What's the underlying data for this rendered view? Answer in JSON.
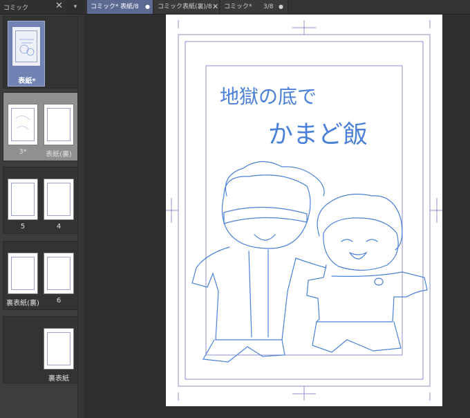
{
  "left_panel": {
    "title": "コミック",
    "close_glyph": "✕",
    "menu_glyph": "▾",
    "spreads": [
      {
        "pages": [
          {
            "label": "表紙*"
          }
        ]
      },
      {
        "pages": [
          {
            "label": "3*"
          },
          {
            "label": "表紙(裏)"
          }
        ]
      },
      {
        "pages": [
          {
            "label": "5"
          },
          {
            "label": "4"
          }
        ]
      },
      {
        "pages": [
          {
            "label": "裏表紙(裏)"
          },
          {
            "label": "6"
          }
        ]
      },
      {
        "pages": [
          {
            "label": "裏表紙"
          }
        ]
      }
    ]
  },
  "tabs": [
    {
      "label": "コミック*",
      "extra": "表紙/8",
      "dot": "●",
      "active": true
    },
    {
      "label": "コミック表紙(裏)/8",
      "close": "✕",
      "active": false
    },
    {
      "label": "コミック*",
      "extra": "3/8",
      "dot": "●",
      "active": false
    }
  ],
  "canvas": {
    "sketch_title_line1": "地獄の底で",
    "sketch_title_line2": "かまど飯",
    "sketch_color": "#4a80d8",
    "guide_color": "#8d8fc8"
  },
  "colors": {
    "panel_bg": "#3d3d3d",
    "active_tab": "#5c6a93",
    "selected_spread": "#909090",
    "canvas_bg": "#2f2f2f"
  }
}
